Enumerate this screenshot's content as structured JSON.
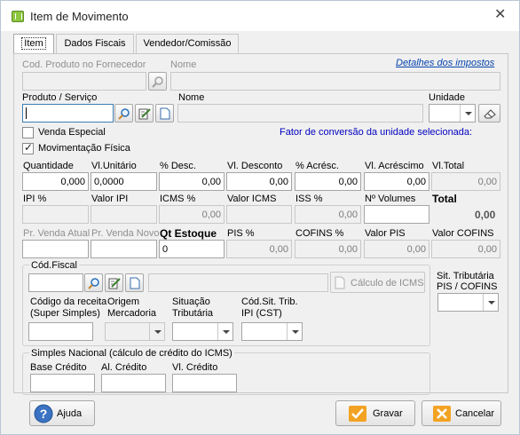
{
  "window": {
    "title": "Item de Movimento"
  },
  "tabs": [
    {
      "label": "Item"
    },
    {
      "label": "Dados Fiscais"
    },
    {
      "label": "Vendedor/Comissão"
    }
  ],
  "produto": {
    "cod_fornecedor_label": "Cod. Produto no Fornecedor",
    "nome_fornecedor_label": "Nome",
    "detalhes_link": "Detalhes dos impostos",
    "produto_label": "Produto / Serviço",
    "nome_label": "Nome",
    "unidade_label": "Unidade",
    "venda_especial_label": "Venda Especial",
    "movimentacao_fisica_label": "Movimentação Física",
    "fator_conversao_text": "Fator de conversão da unidade selecionada:"
  },
  "checkboxes": {
    "venda_especial": false,
    "movimentacao_fisica": true
  },
  "valores": {
    "quantidade_label": "Quantidade",
    "quantidade": "0,000",
    "vl_unitario_label": "Vl.Unitário",
    "vl_unitario": "0,0000",
    "pct_desc_label": "% Desc.",
    "pct_desc": "0,00",
    "vl_desconto_label": "Vl. Desconto",
    "vl_desconto": "0,00",
    "pct_acresc_label": "% Acrésc.",
    "pct_acresc": "0,00",
    "vl_acrescimo_label": "Vl. Acréscimo",
    "vl_acrescimo": "0,00",
    "vl_total_label": "Vl.Total",
    "vl_total": "0,00"
  },
  "impostos": {
    "ipi_pct_label": "IPI %",
    "valor_ipi_label": "Valor IPI",
    "icms_pct_label": "ICMS %",
    "icms_pct": "0,00",
    "valor_icms_label": "Valor ICMS",
    "iss_pct_label": "ISS %",
    "iss_pct": "0,00",
    "n_volumes_label": "Nº Volumes",
    "total_label": "Total",
    "total": "0,00"
  },
  "precos": {
    "pr_venda_atual_label": "Pr. Venda Atual",
    "pr_venda_novo_label": "Pr. Venda Novo",
    "qt_estoque_label": "Qt Estoque",
    "qt_estoque": "0",
    "pis_pct_label": "PIS %",
    "pis_pct": "0,00",
    "cofins_pct_label": "COFINS %",
    "cofins_pct": "0,00",
    "valor_pis_label": "Valor PIS",
    "valor_pis": "0,00",
    "valor_cofins_label": "Valor COFINS",
    "valor_cofins": "0,00"
  },
  "fiscal": {
    "cod_fiscal_label": "Cód.Fiscal",
    "calculo_icms_button": "Cálculo de ICMS",
    "sit_tributaria_pis_label": "Sit. Tributária",
    "sit_tributaria_pis_label2": "PIS / COFINS",
    "codigo_receita_label": "Código da receita",
    "codigo_receita_label2": "(Super Simples)",
    "origem_label": "Origem",
    "origem_label2": "Mercadoria",
    "situacao_label": "Situação",
    "situacao_label2": "Tributária",
    "cod_sit_ipi_label": "Cód.Sit. Trib.",
    "cod_sit_ipi_label2": "IPI (CST)"
  },
  "simples": {
    "legend": "Simples Nacional (cálculo de crédito do ICMS)",
    "base_credito_label": "Base Crédito",
    "al_credito_label": "Al. Crédito",
    "vl_credito_label": "Vl. Crédito"
  },
  "footer": {
    "ajuda_label": "Ajuda",
    "gravar_label": "Gravar",
    "cancelar_label": "Cancelar"
  },
  "colors": {
    "link": "#0645ad",
    "info_text": "#0000c0",
    "accent_orange": "#f3a323"
  }
}
